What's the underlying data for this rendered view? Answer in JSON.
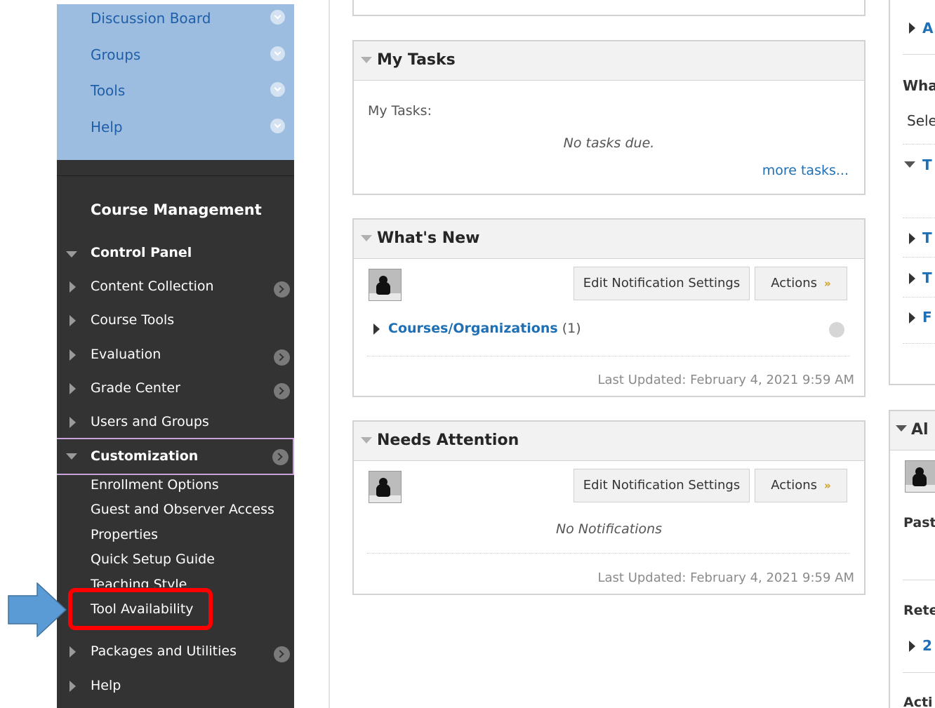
{
  "course_menu": {
    "items": [
      {
        "label": "Discussion Board"
      },
      {
        "label": "Groups"
      },
      {
        "label": "Tools"
      },
      {
        "label": "Help"
      }
    ]
  },
  "course_management": {
    "title": "Course Management",
    "control_panel": "Control Panel",
    "items": [
      {
        "label": "Content Collection"
      },
      {
        "label": "Course Tools"
      },
      {
        "label": "Evaluation"
      },
      {
        "label": "Grade Center"
      },
      {
        "label": "Users and Groups"
      }
    ],
    "customization": {
      "label": "Customization",
      "subitems": [
        {
          "label": "Enrollment Options"
        },
        {
          "label": "Guest and Observer Access"
        },
        {
          "label": "Properties"
        },
        {
          "label": "Quick Setup Guide"
        },
        {
          "label": "Teaching Style"
        },
        {
          "label": "Tool Availability"
        }
      ]
    },
    "packages": "Packages and Utilities",
    "help": "Help"
  },
  "my_tasks": {
    "title": "My Tasks",
    "label": "My Tasks:",
    "empty": "No tasks due.",
    "more": "more tasks..."
  },
  "whats_new": {
    "title": "What's New",
    "edit_btn": "Edit Notification Settings",
    "actions_btn": "Actions",
    "link": "Courses/Organizations",
    "count": "(1)",
    "updated": "Last Updated: February 4, 2021 9:59 AM"
  },
  "needs_attention": {
    "title": "Needs Attention",
    "edit_btn": "Edit Notification Settings",
    "actions_btn": "Actions",
    "empty": "No Notifications",
    "updated": "Last Updated: February 4, 2021 9:59 AM"
  },
  "right_column": {
    "a": "A",
    "wha": "Wha",
    "sele": "Sele",
    "t1": "T",
    "t2": "T",
    "t3": "T",
    "f": "F",
    "alerts": "Al",
    "past": "Past",
    "rete": "Rete",
    "two": "2",
    "acti": "Acti"
  },
  "colors": {
    "menu_bg": "#333333",
    "course_menu_bg": "#9dbde0",
    "link": "#1f6fb5",
    "highlight": "#ff0000",
    "arrow": "#5b9bd5"
  }
}
